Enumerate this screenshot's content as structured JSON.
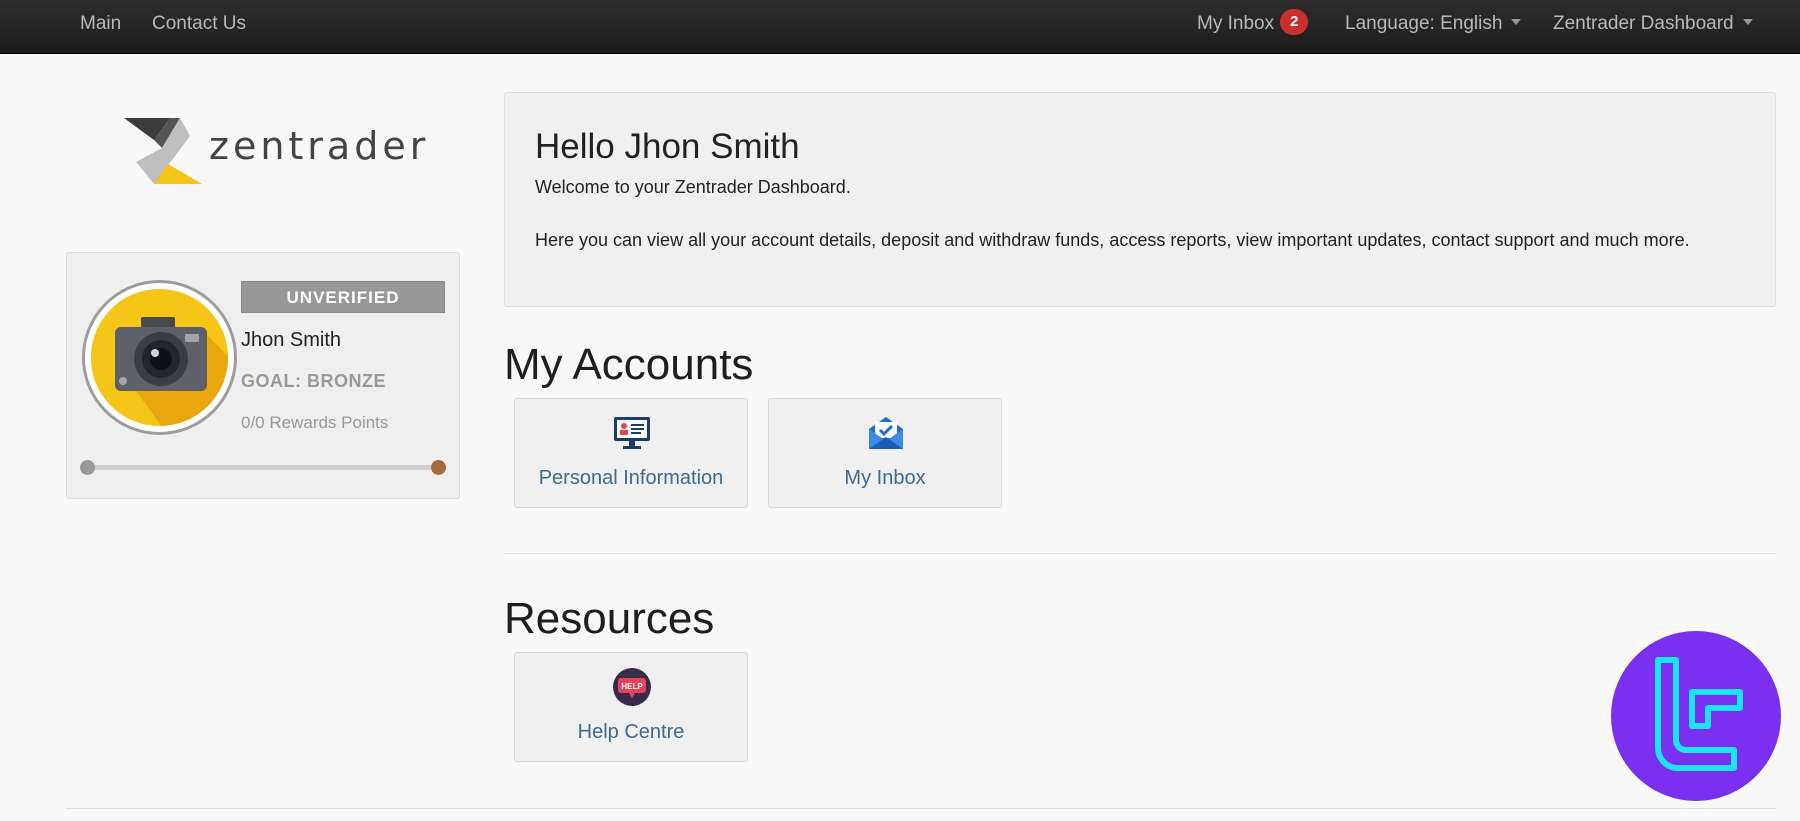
{
  "navbar": {
    "main": "Main",
    "contact": "Contact Us",
    "inbox_label": "My Inbox",
    "inbox_count": "2",
    "language": "Language: English",
    "dashboard": "Zentrader Dashboard"
  },
  "logo": {
    "text": "zentrader"
  },
  "profile": {
    "status": "UNVERIFIED",
    "name": "Jhon Smith",
    "goal": "GOAL: BRONZE",
    "rewards": "0/0 Rewards Points",
    "progress_percent": 0
  },
  "welcome": {
    "title": "Hello Jhon Smith",
    "subtitle": "Welcome to your Zentrader Dashboard.",
    "body": "Here you can view all your account details, deposit and withdraw funds, access reports, view important updates, contact support and much more."
  },
  "accounts": {
    "title": "My Accounts",
    "tiles": [
      {
        "label": "Personal Information",
        "icon": "monitor-id-card-icon"
      },
      {
        "label": "My Inbox",
        "icon": "envelope-check-icon"
      }
    ]
  },
  "resources": {
    "title": "Resources",
    "tiles": [
      {
        "label": "Help Centre",
        "icon": "help-bubble-icon",
        "icon_text": "HELP"
      }
    ]
  },
  "colors": {
    "navbar": "#222222",
    "badge": "#c9302c",
    "tile_link": "#3e6a8f",
    "accent_yellow": "#f5c518",
    "watermark": "#7b2ff0"
  }
}
